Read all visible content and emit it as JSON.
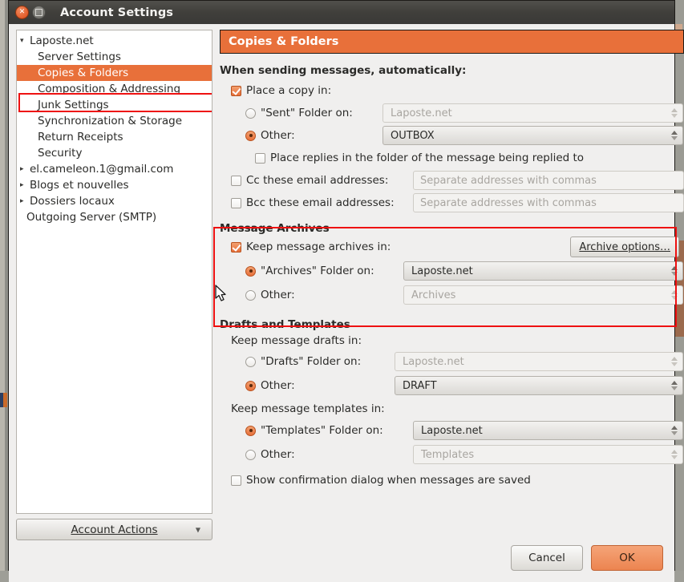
{
  "window": {
    "title": "Account Settings",
    "close_icon": "close-icon",
    "maximize_icon": "maximize-icon"
  },
  "sidebar": {
    "items": [
      {
        "label": "Laposte.net",
        "level": 0,
        "twisty": "▾",
        "selected": false
      },
      {
        "label": "Server Settings",
        "level": 1,
        "twisty": "",
        "selected": false
      },
      {
        "label": "Copies & Folders",
        "level": 1,
        "twisty": "",
        "selected": true
      },
      {
        "label": "Composition & Addressing",
        "level": 1,
        "twisty": "",
        "selected": false
      },
      {
        "label": "Junk Settings",
        "level": 1,
        "twisty": "",
        "selected": false
      },
      {
        "label": "Synchronization & Storage",
        "level": 1,
        "twisty": "",
        "selected": false
      },
      {
        "label": "Return Receipts",
        "level": 1,
        "twisty": "",
        "selected": false
      },
      {
        "label": "Security",
        "level": 1,
        "twisty": "",
        "selected": false
      },
      {
        "label": "el.cameleon.1@gmail.com",
        "level": 0,
        "twisty": "▸",
        "selected": false
      },
      {
        "label": "Blogs et nouvelles",
        "level": 0,
        "twisty": "▸",
        "selected": false
      },
      {
        "label": "Dossiers locaux",
        "level": 0,
        "twisty": "▸",
        "selected": false
      },
      {
        "label": "Outgoing Server (SMTP)",
        "level": 2,
        "twisty": "",
        "selected": false
      }
    ],
    "account_actions": {
      "label": "Account Actions",
      "caret_icon": "chevron-down-icon"
    }
  },
  "main": {
    "header": "Copies & Folders",
    "sending": {
      "heading": "When sending messages, automatically:",
      "place_copy": {
        "label": "Place a copy in:",
        "checked": true
      },
      "sent_folder": {
        "label": "\"Sent\" Folder on:",
        "selected": false,
        "value": "Laposte.net",
        "enabled": false
      },
      "other_sent": {
        "label": "Other:",
        "selected": true,
        "value": "OUTBOX",
        "enabled": true
      },
      "place_replies": {
        "label": "Place replies in the folder of the message being replied to",
        "checked": false
      },
      "cc": {
        "label": "Cc these email addresses:",
        "checked": false,
        "placeholder": "Separate addresses with commas",
        "value": ""
      },
      "bcc": {
        "label": "Bcc these email addresses:",
        "checked": false,
        "placeholder": "Separate addresses with commas",
        "value": ""
      }
    },
    "archives": {
      "title": "Message Archives",
      "keep": {
        "label": "Keep message archives in:",
        "checked": true
      },
      "options_button": "Archive options…",
      "archives_folder": {
        "label": "\"Archives\" Folder on:",
        "selected": true,
        "value": "Laposte.net",
        "enabled": true
      },
      "other": {
        "label": "Other:",
        "selected": false,
        "value": "Archives",
        "enabled": false
      }
    },
    "drafts": {
      "title": "Drafts and Templates",
      "drafts_heading": "Keep message drafts in:",
      "drafts_folder": {
        "label": "\"Drafts\" Folder on:",
        "selected": false,
        "value": "Laposte.net",
        "enabled": false
      },
      "drafts_other": {
        "label": "Other:",
        "selected": true,
        "value": "DRAFT",
        "enabled": true
      },
      "templates_heading": "Keep message templates in:",
      "templates_folder": {
        "label": "\"Templates\" Folder on:",
        "selected": true,
        "value": "Laposte.net",
        "enabled": true
      },
      "templates_other": {
        "label": "Other:",
        "selected": false,
        "value": "Templates",
        "enabled": false
      },
      "show_confirm": {
        "label": "Show confirmation dialog when messages are saved",
        "checked": false
      }
    }
  },
  "footer": {
    "cancel": "Cancel",
    "ok": "OK"
  },
  "annotations": {
    "highlight_color": "#ee1111",
    "accent_color": "#e8703a"
  }
}
